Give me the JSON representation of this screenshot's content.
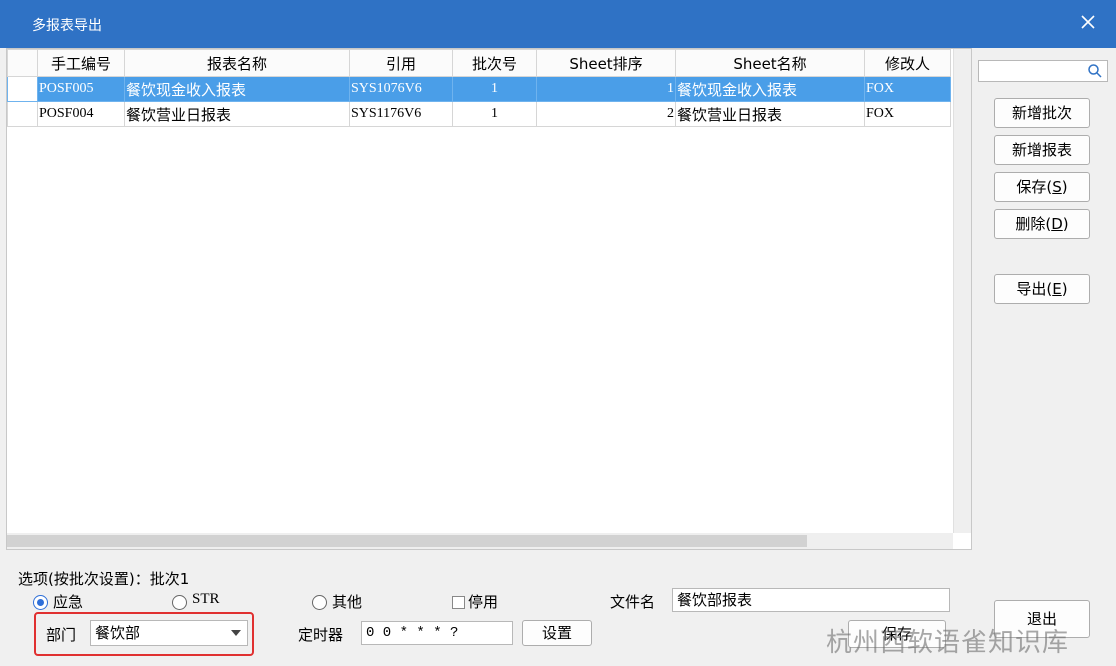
{
  "window": {
    "title": "多报表导出"
  },
  "grid": {
    "columns": [
      "手工编号",
      "报表名称",
      "引用",
      "批次号",
      "Sheet排序",
      "Sheet名称",
      "修改人"
    ],
    "rows": [
      {
        "code": "POSF005",
        "name": "餐饮现金收入报表",
        "ref": "SYS1076V6",
        "batch": "1",
        "order": "1",
        "sheet": "餐饮现金收入报表",
        "modifier": "FOX"
      },
      {
        "code": "POSF004",
        "name": "餐饮营业日报表",
        "ref": "SYS1176V6",
        "batch": "1",
        "order": "2",
        "sheet": "餐饮营业日报表",
        "modifier": "FOX"
      }
    ]
  },
  "side": {
    "search_value": "",
    "add_batch": "新增批次",
    "add_report": "新增报表",
    "save": "保存(",
    "save_key": "S",
    "delete": "删除(",
    "delete_key": "D",
    "export": "导出(",
    "export_key": "E",
    "paren_close": ")",
    "exit": "退出"
  },
  "options": {
    "group_label": "选项(按批次设置)：批次1",
    "radio_emergency": "应急",
    "radio_str": "STR",
    "radio_other": "其他",
    "disabled_label": "停用",
    "filename_label": "文件名",
    "filename_value": "餐饮部报表",
    "dept_label": "部门",
    "dept_value": "餐饮部",
    "timer_label": "定时器",
    "timer_value": "0 0 * * * ?",
    "set_button": "设置",
    "save_button": "保存"
  },
  "watermark": "杭州西软语雀知识库",
  "colors": {
    "title_bar": "#2f72c5",
    "selected_row": "#4a9ee8",
    "highlight_box": "#e03030"
  }
}
